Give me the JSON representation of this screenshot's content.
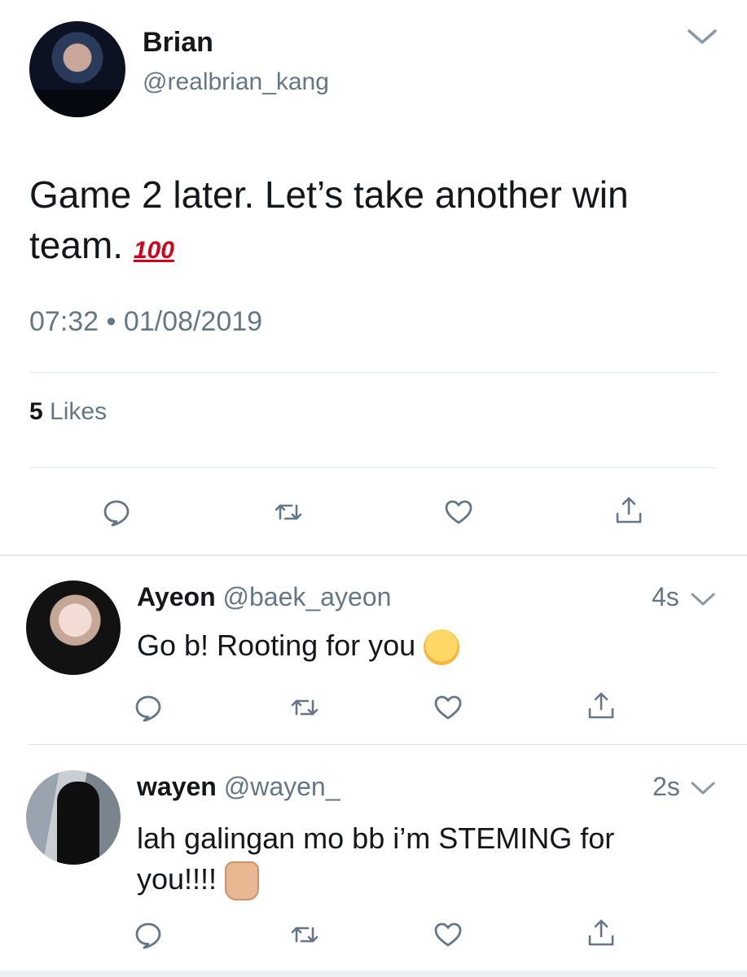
{
  "tweet": {
    "name": "Brian",
    "handle": "@realbrian_kang",
    "text": "Game 2 later. Let’s take another win team.",
    "emoji": "100",
    "time": "07:32",
    "dot": "•",
    "date": "01/08/2019",
    "likes_count": "5",
    "likes_label": "Likes"
  },
  "replies": [
    {
      "name": "Ayeon",
      "handle": "@baek_ayeon",
      "time": "4s",
      "text": "Go b! Rooting for you"
    },
    {
      "name": "wayen",
      "handle": "@wayen_",
      "time": "2s",
      "text_line1": "lah galingan mo bb i’m STEMING for",
      "text_line2": "you!!!!"
    }
  ],
  "icons": {
    "reply": "reply-icon",
    "retweet": "retweet-icon",
    "like": "heart-icon",
    "share": "share-icon",
    "more": "chevron-down-icon"
  },
  "colors": {
    "text": "#14171a",
    "secondary": "#657786",
    "divider": "#e1e8ed"
  }
}
